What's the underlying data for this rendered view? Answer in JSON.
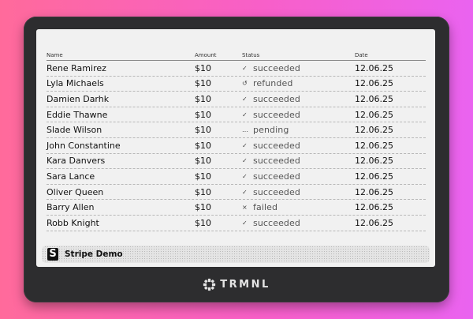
{
  "table": {
    "headers": {
      "name": "Name",
      "amount": "Amount",
      "status": "Status",
      "date": "Date"
    },
    "rows": [
      {
        "name": "Rene Ramirez",
        "amount": "$10",
        "status_icon": "check-icon",
        "status_glyph": "✓",
        "status": "succeeded",
        "date": "12.06.25"
      },
      {
        "name": "Lyla Michaels",
        "amount": "$10",
        "status_icon": "refund-icon",
        "status_glyph": "↺",
        "status": "refunded",
        "date": "12.06.25"
      },
      {
        "name": "Damien Darhk",
        "amount": "$10",
        "status_icon": "check-icon",
        "status_glyph": "✓",
        "status": "succeeded",
        "date": "12.06.25"
      },
      {
        "name": "Eddie Thawne",
        "amount": "$10",
        "status_icon": "check-icon",
        "status_glyph": "✓",
        "status": "succeeded",
        "date": "12.06.25"
      },
      {
        "name": "Slade Wilson",
        "amount": "$10",
        "status_icon": "pending-icon",
        "status_glyph": "…",
        "status": "pending",
        "date": "12.06.25"
      },
      {
        "name": "John Constantine",
        "amount": "$10",
        "status_icon": "check-icon",
        "status_glyph": "✓",
        "status": "succeeded",
        "date": "12.06.25"
      },
      {
        "name": "Kara Danvers",
        "amount": "$10",
        "status_icon": "check-icon",
        "status_glyph": "✓",
        "status": "succeeded",
        "date": "12.06.25"
      },
      {
        "name": "Sara Lance",
        "amount": "$10",
        "status_icon": "check-icon",
        "status_glyph": "✓",
        "status": "succeeded",
        "date": "12.06.25"
      },
      {
        "name": "Oliver Queen",
        "amount": "$10",
        "status_icon": "check-icon",
        "status_glyph": "✓",
        "status": "succeeded",
        "date": "12.06.25"
      },
      {
        "name": "Barry Allen",
        "amount": "$10",
        "status_icon": "x-icon",
        "status_glyph": "×",
        "status": "failed",
        "date": "12.06.25"
      },
      {
        "name": "Robb Knight",
        "amount": "$10",
        "status_icon": "check-icon",
        "status_glyph": "✓",
        "status": "succeeded",
        "date": "12.06.25"
      }
    ]
  },
  "footer": {
    "logo_letter": "S",
    "title": "Stripe Demo"
  },
  "brand": {
    "name": "TRMNL",
    "icon": "trmnl-logo-icon"
  },
  "colors": {
    "background_left": "#ff6a9b",
    "background_right": "#ea63f0",
    "device": "#2d2d2f",
    "screen": "#f1f1f1"
  }
}
